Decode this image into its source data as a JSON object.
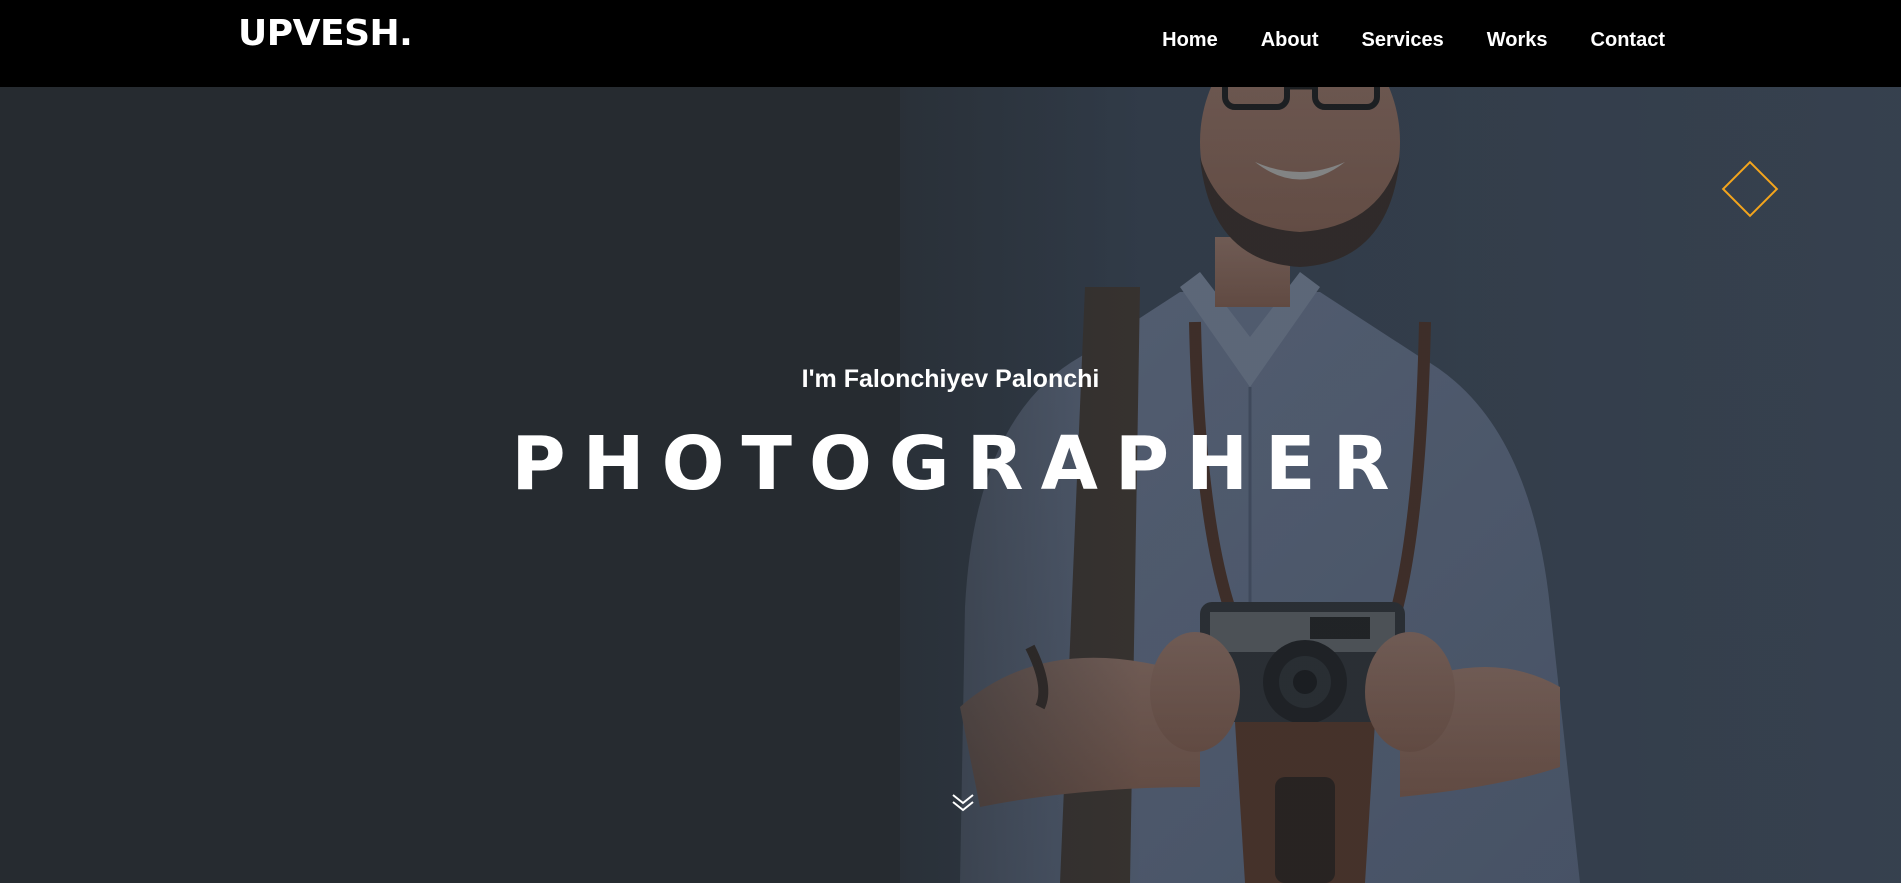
{
  "brand": {
    "logo": "UPVESH."
  },
  "nav": {
    "items": [
      {
        "label": "Home"
      },
      {
        "label": "About"
      },
      {
        "label": "Services"
      },
      {
        "label": "Works"
      },
      {
        "label": "Contact"
      }
    ]
  },
  "hero": {
    "subtitle": "I'm Falonchiyev Palonchi",
    "title": "PHOTOGRAPHER",
    "background_photo": "man-smiling-holding-vintage-camera",
    "scroll_icon": "double-chevron-down-icon"
  },
  "colors": {
    "navbar": "#000000",
    "hero_bg": "#262b30",
    "accent": "#f4a51c",
    "text": "#ffffff"
  }
}
